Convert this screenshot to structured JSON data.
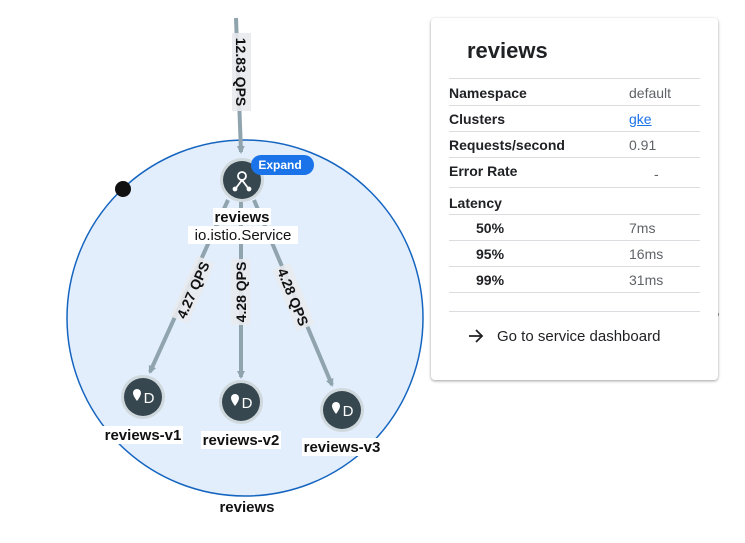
{
  "graph": {
    "top_edge_label": "12.83 QPS",
    "edge_labels": [
      "4.27 QPS",
      "4.28 QPS",
      "4.28 QPS"
    ],
    "service_node": {
      "name": "reviews",
      "type": "io.istio.Service",
      "icon": "service-hub-icon"
    },
    "expand_label": "Expand",
    "workloads": [
      {
        "name": "reviews-v1",
        "icon_text": "D",
        "icon": "location-pin-icon"
      },
      {
        "name": "reviews-v2",
        "icon_text": "D",
        "icon": "location-pin-icon"
      },
      {
        "name": "reviews-v3",
        "icon_text": "D",
        "icon": "location-pin-icon"
      }
    ],
    "group_label": "reviews",
    "colors": {
      "group_fill": "#e3eefc",
      "group_stroke": "#1565c0",
      "node_fill": "#37474f",
      "expand_fill": "#1a73e8",
      "edge": "#90a4ae"
    }
  },
  "panel": {
    "title": "reviews",
    "rows": [
      {
        "key": "Namespace",
        "value": "default"
      },
      {
        "key": "Clusters",
        "value": "gke"
      },
      {
        "key": "Requests/second",
        "value": "0.91"
      },
      {
        "key": "Error Rate",
        "value": "-"
      }
    ],
    "latency_label": "Latency",
    "latency": [
      {
        "key": "50%",
        "value": "7ms"
      },
      {
        "key": "95%",
        "value": "16ms"
      },
      {
        "key": "99%",
        "value": "31ms"
      }
    ],
    "dashboard_link": "Go to service dashboard",
    "dashboard_icon": "arrow-right-icon"
  }
}
